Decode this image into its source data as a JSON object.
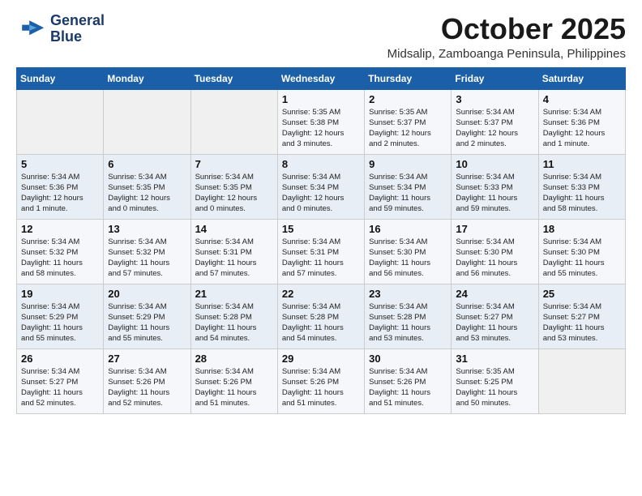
{
  "logo": {
    "name": "General Blue",
    "line1": "General",
    "line2": "Blue"
  },
  "header": {
    "month_year": "October 2025",
    "location": "Midsalip, Zamboanga Peninsula, Philippines"
  },
  "days_of_week": [
    "Sunday",
    "Monday",
    "Tuesday",
    "Wednesday",
    "Thursday",
    "Friday",
    "Saturday"
  ],
  "weeks": [
    [
      {
        "day": "",
        "info": ""
      },
      {
        "day": "",
        "info": ""
      },
      {
        "day": "",
        "info": ""
      },
      {
        "day": "1",
        "info": "Sunrise: 5:35 AM\nSunset: 5:38 PM\nDaylight: 12 hours\nand 3 minutes."
      },
      {
        "day": "2",
        "info": "Sunrise: 5:35 AM\nSunset: 5:37 PM\nDaylight: 12 hours\nand 2 minutes."
      },
      {
        "day": "3",
        "info": "Sunrise: 5:34 AM\nSunset: 5:37 PM\nDaylight: 12 hours\nand 2 minutes."
      },
      {
        "day": "4",
        "info": "Sunrise: 5:34 AM\nSunset: 5:36 PM\nDaylight: 12 hours\nand 1 minute."
      }
    ],
    [
      {
        "day": "5",
        "info": "Sunrise: 5:34 AM\nSunset: 5:36 PM\nDaylight: 12 hours\nand 1 minute."
      },
      {
        "day": "6",
        "info": "Sunrise: 5:34 AM\nSunset: 5:35 PM\nDaylight: 12 hours\nand 0 minutes."
      },
      {
        "day": "7",
        "info": "Sunrise: 5:34 AM\nSunset: 5:35 PM\nDaylight: 12 hours\nand 0 minutes."
      },
      {
        "day": "8",
        "info": "Sunrise: 5:34 AM\nSunset: 5:34 PM\nDaylight: 12 hours\nand 0 minutes."
      },
      {
        "day": "9",
        "info": "Sunrise: 5:34 AM\nSunset: 5:34 PM\nDaylight: 11 hours\nand 59 minutes."
      },
      {
        "day": "10",
        "info": "Sunrise: 5:34 AM\nSunset: 5:33 PM\nDaylight: 11 hours\nand 59 minutes."
      },
      {
        "day": "11",
        "info": "Sunrise: 5:34 AM\nSunset: 5:33 PM\nDaylight: 11 hours\nand 58 minutes."
      }
    ],
    [
      {
        "day": "12",
        "info": "Sunrise: 5:34 AM\nSunset: 5:32 PM\nDaylight: 11 hours\nand 58 minutes."
      },
      {
        "day": "13",
        "info": "Sunrise: 5:34 AM\nSunset: 5:32 PM\nDaylight: 11 hours\nand 57 minutes."
      },
      {
        "day": "14",
        "info": "Sunrise: 5:34 AM\nSunset: 5:31 PM\nDaylight: 11 hours\nand 57 minutes."
      },
      {
        "day": "15",
        "info": "Sunrise: 5:34 AM\nSunset: 5:31 PM\nDaylight: 11 hours\nand 57 minutes."
      },
      {
        "day": "16",
        "info": "Sunrise: 5:34 AM\nSunset: 5:30 PM\nDaylight: 11 hours\nand 56 minutes."
      },
      {
        "day": "17",
        "info": "Sunrise: 5:34 AM\nSunset: 5:30 PM\nDaylight: 11 hours\nand 56 minutes."
      },
      {
        "day": "18",
        "info": "Sunrise: 5:34 AM\nSunset: 5:30 PM\nDaylight: 11 hours\nand 55 minutes."
      }
    ],
    [
      {
        "day": "19",
        "info": "Sunrise: 5:34 AM\nSunset: 5:29 PM\nDaylight: 11 hours\nand 55 minutes."
      },
      {
        "day": "20",
        "info": "Sunrise: 5:34 AM\nSunset: 5:29 PM\nDaylight: 11 hours\nand 55 minutes."
      },
      {
        "day": "21",
        "info": "Sunrise: 5:34 AM\nSunset: 5:28 PM\nDaylight: 11 hours\nand 54 minutes."
      },
      {
        "day": "22",
        "info": "Sunrise: 5:34 AM\nSunset: 5:28 PM\nDaylight: 11 hours\nand 54 minutes."
      },
      {
        "day": "23",
        "info": "Sunrise: 5:34 AM\nSunset: 5:28 PM\nDaylight: 11 hours\nand 53 minutes."
      },
      {
        "day": "24",
        "info": "Sunrise: 5:34 AM\nSunset: 5:27 PM\nDaylight: 11 hours\nand 53 minutes."
      },
      {
        "day": "25",
        "info": "Sunrise: 5:34 AM\nSunset: 5:27 PM\nDaylight: 11 hours\nand 53 minutes."
      }
    ],
    [
      {
        "day": "26",
        "info": "Sunrise: 5:34 AM\nSunset: 5:27 PM\nDaylight: 11 hours\nand 52 minutes."
      },
      {
        "day": "27",
        "info": "Sunrise: 5:34 AM\nSunset: 5:26 PM\nDaylight: 11 hours\nand 52 minutes."
      },
      {
        "day": "28",
        "info": "Sunrise: 5:34 AM\nSunset: 5:26 PM\nDaylight: 11 hours\nand 51 minutes."
      },
      {
        "day": "29",
        "info": "Sunrise: 5:34 AM\nSunset: 5:26 PM\nDaylight: 11 hours\nand 51 minutes."
      },
      {
        "day": "30",
        "info": "Sunrise: 5:34 AM\nSunset: 5:26 PM\nDaylight: 11 hours\nand 51 minutes."
      },
      {
        "day": "31",
        "info": "Sunrise: 5:35 AM\nSunset: 5:25 PM\nDaylight: 11 hours\nand 50 minutes."
      },
      {
        "day": "",
        "info": ""
      }
    ]
  ]
}
